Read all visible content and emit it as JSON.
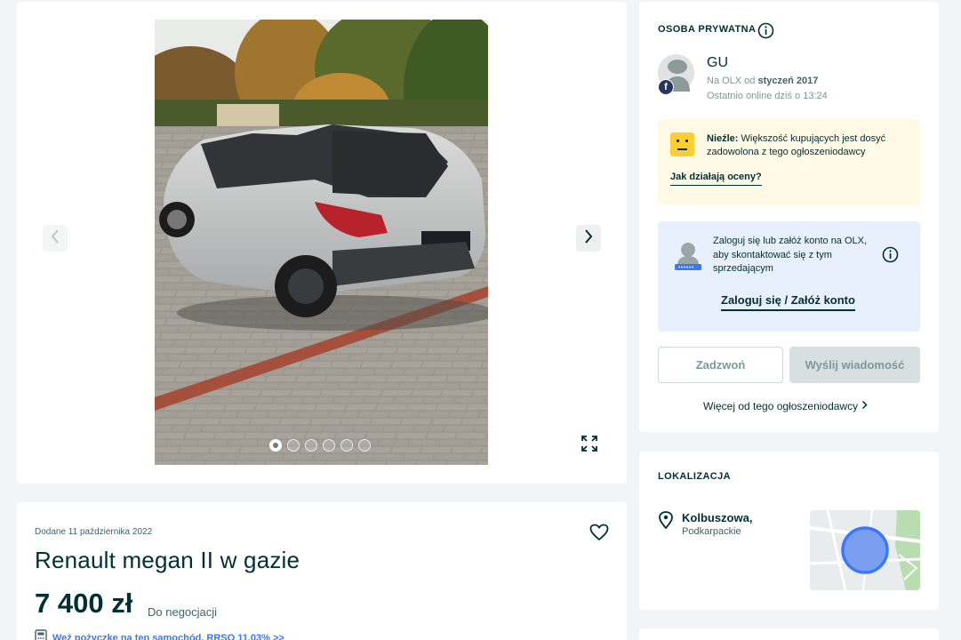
{
  "gallery": {
    "image_alt": "Renault Megane II silver hatchback",
    "photo_count": 6,
    "active_index": 0
  },
  "listing": {
    "added_date": "Dodane 11 października 2022",
    "title": "Renault megan II w gazie",
    "price": "7 400 zł",
    "negotiable": "Do negocjacji",
    "loan_link": "Weź pożyczkę na ten samochód. RRSO 11,03% >>"
  },
  "seller": {
    "section_title": "OSOBA PRYWATNA",
    "name": "GU",
    "member_prefix": "Na OLX od ",
    "member_since": "styczeń 2017",
    "last_online": "Ostatnio online dziś o 13:24",
    "facebook_badge": "f",
    "rating_label": "Nieźle:",
    "rating_text": " Większość kupujących jest dosyć zadowolona z tego ogłoszeniodawcy",
    "rating_link": "Jak działają oceny?",
    "login_text": "Zaloguj się lub załóż konto na OLX, aby skontaktować się z tym sprzedającym",
    "login_link": "Zaloguj się / Załóż konto",
    "call_button": "Zadzwoń",
    "message_button": "Wyślij wiadomość",
    "more_link": "Więcej od tego ogłoszeniodawcy"
  },
  "location": {
    "section_title": "LOKALIZACJA",
    "city": "Kolbuszowa,",
    "region": "Podkarpackie"
  },
  "colors": {
    "primary": "#002f34",
    "link": "#3a77ff",
    "rating_bg": "#fff9e6",
    "login_bg": "#e8f0fe",
    "page_bg": "#f2f4f5"
  }
}
